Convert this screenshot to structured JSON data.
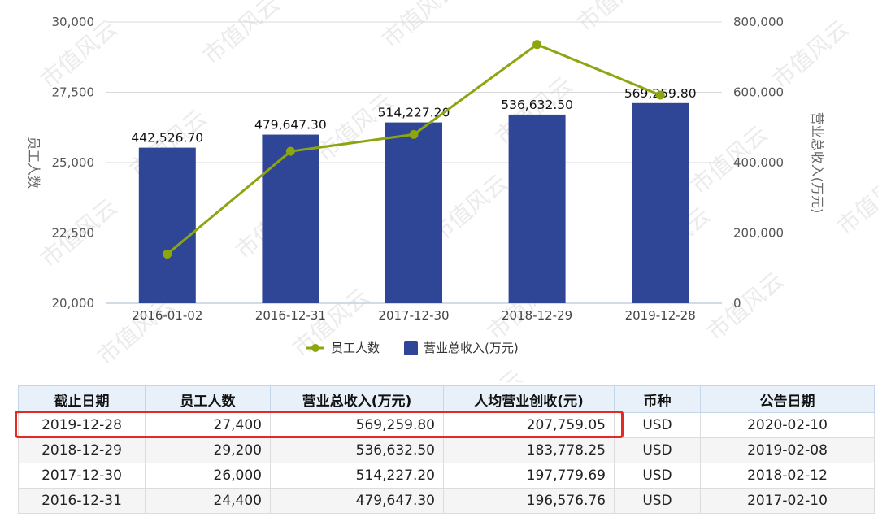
{
  "chart_data": {
    "type": "bar+line",
    "categories": [
      "2016-01-02",
      "2016-12-31",
      "2017-12-30",
      "2018-12-29",
      "2019-12-28"
    ],
    "series": [
      {
        "name": "营业总收入(万元)",
        "chart_type": "bar",
        "axis": "right",
        "color": "#2f4595",
        "values": [
          442526.7,
          479647.3,
          514227.2,
          536632.5,
          569259.8
        ],
        "labels": [
          "442,526.70",
          "479,647.30",
          "514,227.20",
          "536,632.50",
          "569,259.80"
        ]
      },
      {
        "name": "员工人数",
        "chart_type": "line",
        "axis": "left",
        "color": "#8ca610",
        "values": [
          21750,
          25400,
          26000,
          29200,
          27400
        ]
      }
    ],
    "ylabel": "员工人数",
    "y2label": "营业总收入(万元)",
    "ylim": [
      20000,
      30000
    ],
    "y2lim": [
      0,
      800000
    ],
    "yticks": [
      "20,000",
      "22,500",
      "25,000",
      "27,500",
      "30,000"
    ],
    "y2ticks": [
      "0",
      "200,000",
      "400,000",
      "600,000",
      "800,000"
    ],
    "grid": true,
    "legend_position": "bottom-center"
  },
  "watermark": "市值风云",
  "table": {
    "headers": [
      "截止日期",
      "员工人数",
      "营业总收入(万元)",
      "人均营业创收(元)",
      "币种",
      "公告日期"
    ],
    "rows": [
      [
        "2019-12-28",
        "27,400",
        "569,259.80",
        "207,759.05",
        "USD",
        "2020-02-10"
      ],
      [
        "2018-12-29",
        "29,200",
        "536,632.50",
        "183,778.25",
        "USD",
        "2019-02-08"
      ],
      [
        "2017-12-30",
        "26,000",
        "514,227.20",
        "197,779.69",
        "USD",
        "2018-02-12"
      ],
      [
        "2016-12-31",
        "24,400",
        "479,647.30",
        "196,576.76",
        "USD",
        "2017-02-10"
      ]
    ],
    "highlight_color": "#e52a24"
  }
}
